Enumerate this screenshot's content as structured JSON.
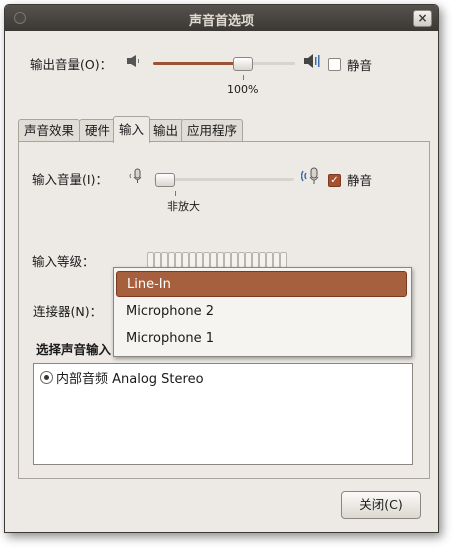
{
  "window": {
    "title": "声音首选项",
    "close_glyph": "×"
  },
  "output": {
    "label": "输出音量(O)：",
    "percent": "100%",
    "level": 1.0,
    "mute_label": "静音",
    "muted": false
  },
  "tabs": [
    {
      "label": "声音效果",
      "active": false
    },
    {
      "label": "硬件",
      "active": false
    },
    {
      "label": "输入",
      "active": true
    },
    {
      "label": "输出",
      "active": false
    },
    {
      "label": "应用程序",
      "active": false
    }
  ],
  "input": {
    "label": "输入音量(I)：",
    "level": 0.0,
    "unamplified_label": "非放大",
    "mute_label": "静音",
    "muted": true,
    "level_label": "输入等级：",
    "connector_label": "连接器(N)：",
    "select_label": "选择声音输入",
    "dropdown_options": [
      "Line-In",
      "Microphone 2",
      "Microphone 1"
    ],
    "selected_option": "Line-In",
    "devices": [
      {
        "label": "内部音频 Analog Stereo",
        "selected": true
      }
    ]
  },
  "footer": {
    "close_button": "关闭(C)"
  },
  "icons": {
    "speaker_low": "speaker-low-icon",
    "speaker_high": "speaker-high-icon",
    "mic_low": "microphone-low-icon",
    "mic_high": "microphone-high-icon"
  }
}
